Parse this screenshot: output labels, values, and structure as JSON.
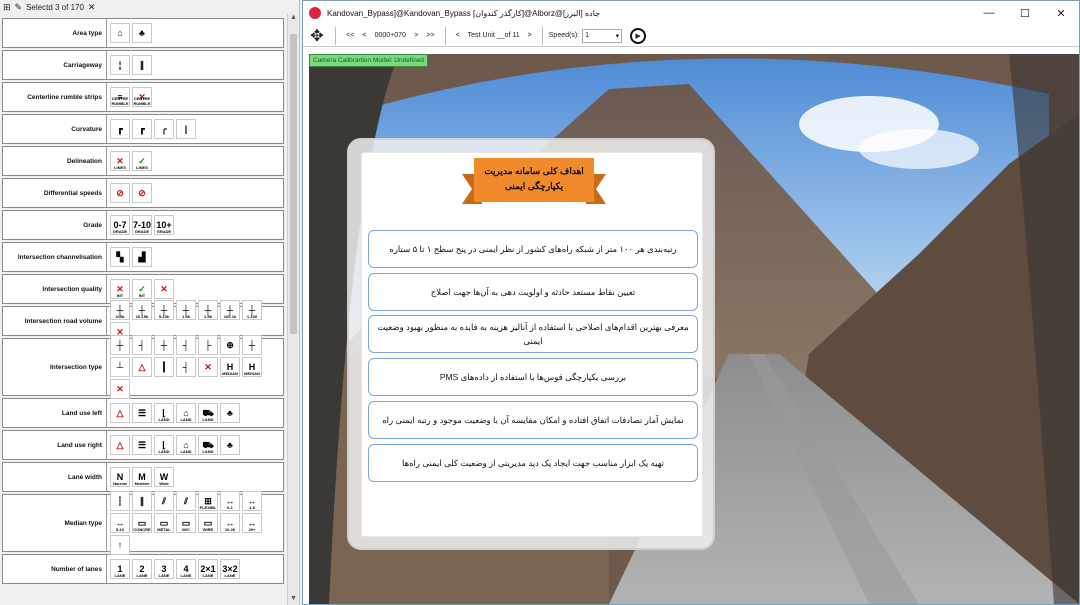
{
  "left_panel": {
    "toolbar": {
      "selection_label": "Selectd 3 of 170",
      "close_glyph": "✕"
    },
    "rows": [
      {
        "label": "Area type",
        "icons": [
          {
            "text": "⌂"
          },
          {
            "text": "♣"
          }
        ]
      },
      {
        "label": "Carriageway",
        "icons": [
          {
            "text": "¦"
          },
          {
            "text": "∥"
          }
        ]
      },
      {
        "label": "Centerline rumble strips",
        "icons": [
          {
            "text": "≡",
            "sub": "CENTRE RUMBLE"
          },
          {
            "text": "✕",
            "sub": "CENTRE RUMBLE",
            "tone": "red"
          }
        ]
      },
      {
        "label": "Curvature",
        "icons": [
          {
            "text": "┏"
          },
          {
            "text": "┏"
          },
          {
            "text": "╭"
          },
          {
            "text": "|"
          }
        ]
      },
      {
        "label": "Delineation",
        "icons": [
          {
            "text": "✕",
            "sub": "LINES",
            "tone": "red"
          },
          {
            "text": "✓",
            "sub": "LINES",
            "tone": "grn"
          }
        ]
      },
      {
        "label": "Differential speeds",
        "icons": [
          {
            "text": "⊘",
            "tone": "red"
          },
          {
            "text": "⊘",
            "tone": "red"
          }
        ]
      },
      {
        "label": "Grade",
        "icons": [
          {
            "text": "0-7",
            "sub": "GRADE"
          },
          {
            "text": "7-10",
            "sub": "GRADE"
          },
          {
            "text": "10+",
            "sub": "GRADE"
          }
        ]
      },
      {
        "label": "Intersection channelisation",
        "icons": [
          {
            "text": "▚"
          },
          {
            "text": "▟"
          }
        ]
      },
      {
        "label": "Intersection quality",
        "icons": [
          {
            "text": "✕",
            "sub": "INT",
            "tone": "red"
          },
          {
            "text": "✓",
            "sub": "INT",
            "tone": "grn"
          },
          {
            "text": "✕",
            "tone": "red"
          }
        ]
      },
      {
        "label": "Intersection road volume",
        "icons": [
          {
            "text": "┼",
            "sub": "≥15k"
          },
          {
            "text": "┼",
            "sub": "10-15k"
          },
          {
            "text": "┼",
            "sub": "5-10k"
          },
          {
            "text": "┼",
            "sub": "1-5k"
          },
          {
            "text": "┼",
            "sub": "1-5k"
          },
          {
            "text": "┼",
            "sub": "100-1k"
          },
          {
            "text": "┼",
            "sub": "1-100"
          },
          {
            "text": "✕",
            "tone": "red"
          }
        ]
      },
      {
        "label": "Intersection type",
        "icons": [
          {
            "text": "┼"
          },
          {
            "text": "┤"
          },
          {
            "text": "┼"
          },
          {
            "text": "┤"
          },
          {
            "text": "├"
          },
          {
            "text": "⊕"
          },
          {
            "text": "┼"
          },
          {
            "text": "┴"
          },
          {
            "text": "△",
            "tone": "red"
          },
          {
            "text": "┃"
          },
          {
            "text": "┤"
          },
          {
            "text": "✕",
            "tone": "red"
          },
          {
            "text": "H",
            "sub": "MEDIAN"
          },
          {
            "text": "H",
            "sub": "MEDIAN"
          },
          {
            "text": "✕",
            "tone": "red"
          }
        ]
      },
      {
        "label": "Land use left",
        "icons": [
          {
            "text": "△",
            "tone": "red"
          },
          {
            "text": "☰"
          },
          {
            "text": "⌊",
            "sub": "LAND"
          },
          {
            "text": "⌂",
            "sub": "LAND"
          },
          {
            "text": "⛟",
            "sub": "LAND"
          },
          {
            "text": "♣"
          }
        ]
      },
      {
        "label": "Land use right",
        "icons": [
          {
            "text": "△",
            "tone": "red"
          },
          {
            "text": "☰"
          },
          {
            "text": "⌊",
            "sub": "LAND"
          },
          {
            "text": "⌂",
            "sub": "LAND"
          },
          {
            "text": "⛟",
            "sub": "LAND"
          },
          {
            "text": "♣"
          }
        ]
      },
      {
        "label": "Lane width",
        "icons": [
          {
            "text": "N",
            "sub": "Narrow"
          },
          {
            "text": "M",
            "sub": "Medium"
          },
          {
            "text": "W",
            "sub": "Wide"
          }
        ]
      },
      {
        "label": "Median type",
        "icons": [
          {
            "text": "┆"
          },
          {
            "text": "∥"
          },
          {
            "text": "⫽"
          },
          {
            "text": "⫽"
          },
          {
            "text": "⊞",
            "sub": "FLEXIBL"
          },
          {
            "text": "↔",
            "sub": "0-1"
          },
          {
            "text": "↔",
            "sub": "1-5"
          },
          {
            "text": "↔",
            "sub": "5-10"
          },
          {
            "text": "▭",
            "sub": "CONCRE"
          },
          {
            "text": "▭",
            "sub": "METAL"
          },
          {
            "text": "▭",
            "sub": "W/C"
          },
          {
            "text": "▭",
            "sub": "WIRE"
          },
          {
            "text": "↔",
            "sub": "10-20"
          },
          {
            "text": "↔",
            "sub": "20+"
          },
          {
            "text": "↑"
          }
        ]
      },
      {
        "label": "Number of lanes",
        "icons": [
          {
            "text": "1",
            "sub": "LANE"
          },
          {
            "text": "2",
            "sub": "LANE"
          },
          {
            "text": "3",
            "sub": "LANE"
          },
          {
            "text": "4",
            "sub": "LANE"
          },
          {
            "text": "2×1",
            "sub": "LANE"
          },
          {
            "text": "3×2",
            "sub": "LANE"
          }
        ]
      }
    ]
  },
  "video_window": {
    "title": "Kandovan_Bypass]@Kandovan_Bypass [کارگذر کندوان]@Alborz@جاده [البرز]",
    "controls": {
      "first": "<<",
      "prev": "<",
      "frame_value": "0000+070",
      "next": ">",
      "last": ">>",
      "prev_unit": "<",
      "unit_label": "Test Unit __of 11",
      "next_unit": ">",
      "speed_label": "Speed(s):",
      "speed_value": "1"
    },
    "calibration_badge": "Camera Calibrartion Model: Undefined"
  },
  "slide": {
    "title_line1": "اهداف کلی سامانه مدیریت",
    "title_line2": "یکپارچگی ایمنی",
    "goals": [
      "رتبه‌بندی هر ۱۰۰ متر از شبکه راه‌های کشور از نظر ایمنی در پنج سطح ۱ تا ۵ ستاره",
      "تعیین نقاط مستعد حادثه و اولویت دهی به آن‌ها جهت اصلاح",
      "معرفی بهترین اقدام‌های اصلاحی با استفاده از آنالیز هزینه به فایده به منظور بهبود وضعیت ایمنی",
      "بررسی یکپارچگی قوس‌ها با استفاده از داده‌های PMS",
      "نمایش آمار تصادفات اتفاق افتاده و امکان مقایسه آن با وضعیت موجود و رتبه ایمنی راه",
      "تهیه یک ابزار مناسب جهت ایجاد یک دید مدیریتی از وضعیت کلی ایمنی راه‌ها"
    ]
  },
  "colors": {
    "ribbon": "#f08a2a",
    "ribbon_dark": "#c96a18",
    "goal_border": "#7fa6d8",
    "badge": "#7dd87d"
  }
}
